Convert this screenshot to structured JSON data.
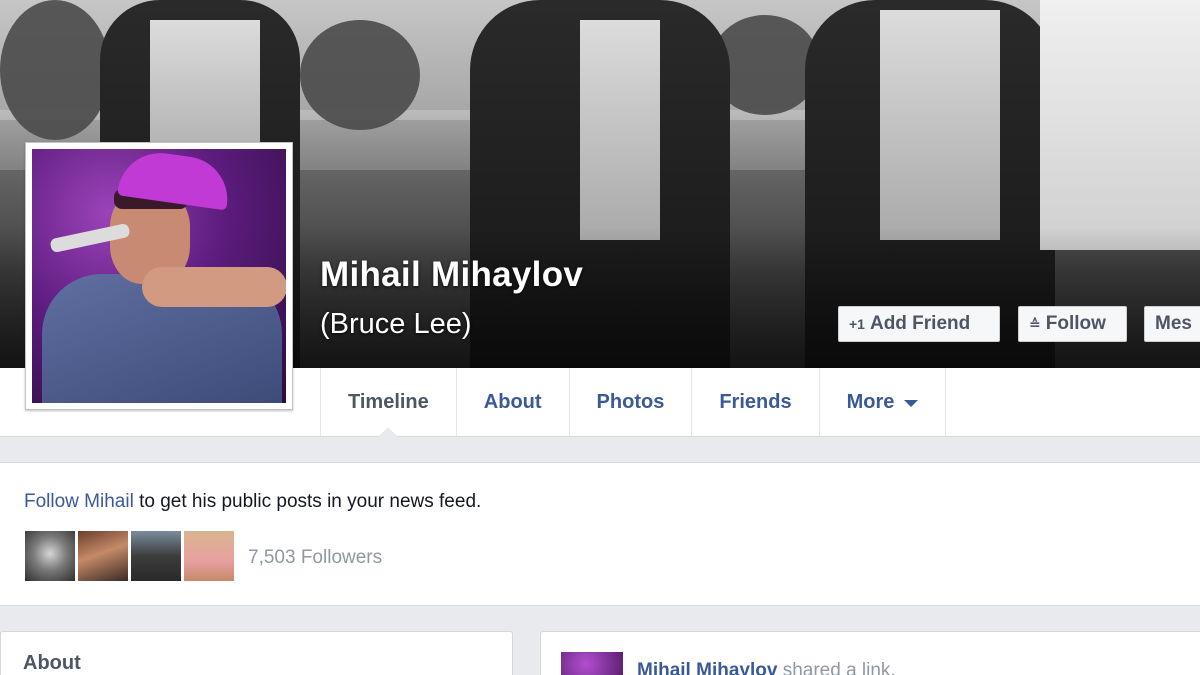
{
  "profile": {
    "name": "Mihail Mihaylov",
    "alternate_name": "(Bruce Lee)"
  },
  "actions": {
    "add_friend": "Add Friend",
    "follow": "Follow",
    "message": "Mes"
  },
  "tabs": [
    {
      "label": "Timeline",
      "active": true
    },
    {
      "label": "About"
    },
    {
      "label": "Photos"
    },
    {
      "label": "Friends"
    },
    {
      "label": "More"
    }
  ],
  "follow_box": {
    "link": "Follow Mihail",
    "text": " to get his public posts in your news feed.",
    "followers": "7,503 Followers"
  },
  "about_card": {
    "title": "About"
  },
  "post": {
    "author": "Mihail Mihaylov",
    "action": " shared a link."
  },
  "colors": {
    "link_blue": "#3b5998",
    "text_gray": "#4e5665",
    "page_bg": "#e9eaed"
  },
  "icons": {
    "add_friend": "add-friend-icon",
    "follow": "rss-icon",
    "more": "chevron-down-icon"
  }
}
